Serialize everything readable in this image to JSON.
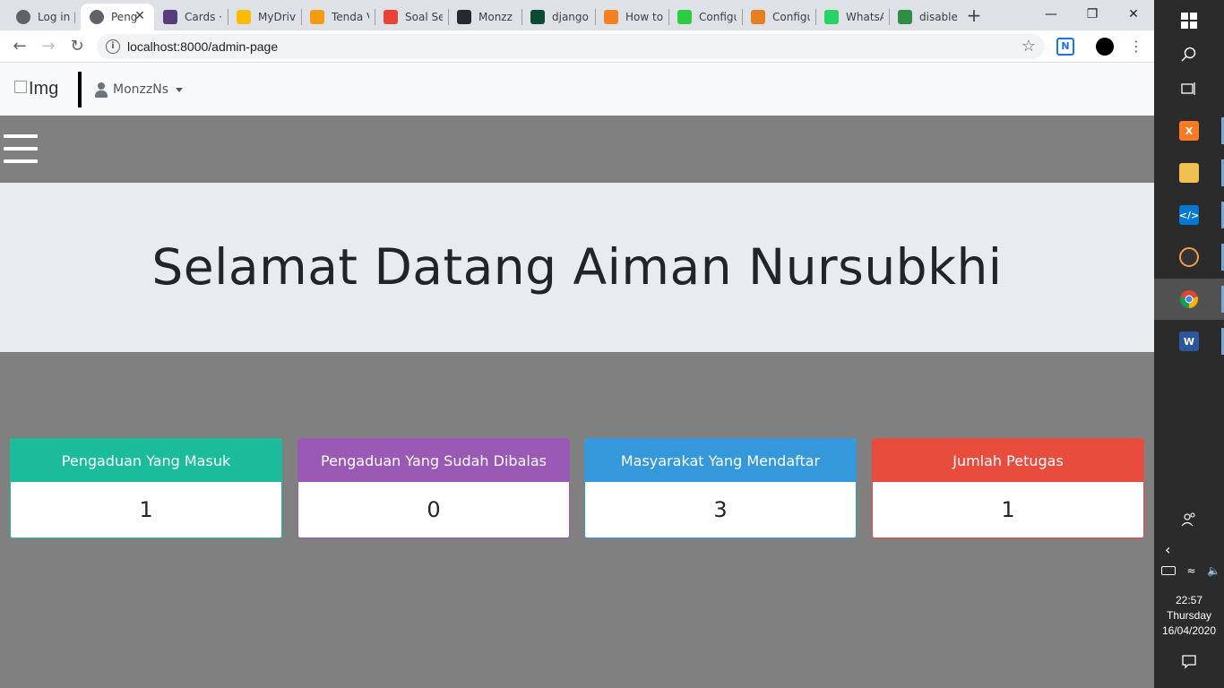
{
  "browser": {
    "tabs": [
      {
        "title": "Log in |",
        "favicon": "globe-icon",
        "color": "#5f6368"
      },
      {
        "title": "Peng",
        "favicon": "globe-icon",
        "color": "#5f6368",
        "active": true
      },
      {
        "title": "Cards ·",
        "favicon": "bootstrap-icon",
        "color": "#563d7c"
      },
      {
        "title": "MyDrive",
        "favicon": "drive-icon",
        "color": "#fbbc04"
      },
      {
        "title": "Tenda V",
        "favicon": "tenda-icon",
        "color": "#f39c12"
      },
      {
        "title": "Soal Se",
        "favicon": "gmail-icon",
        "color": "#ea4335"
      },
      {
        "title": "Monzz",
        "favicon": "github-icon",
        "color": "#24292e"
      },
      {
        "title": "django",
        "favicon": "django-icon",
        "color": "#0c4b33"
      },
      {
        "title": "How to",
        "favicon": "stackoverflow-icon",
        "color": "#f48024"
      },
      {
        "title": "Configu",
        "favicon": "power-icon",
        "color": "#2ecc40"
      },
      {
        "title": "Configu",
        "favicon": "hi-icon",
        "color": "#e67e22"
      },
      {
        "title": "WhatsA",
        "favicon": "whatsapp-icon",
        "color": "#25d366"
      },
      {
        "title": "disablec",
        "favicon": "geeks-icon",
        "color": "#2f8d46"
      }
    ],
    "new_tab_label": "+",
    "url": "localhost:8000/admin-page"
  },
  "navbar": {
    "brand_alt": "Img",
    "username": "MonzzNs"
  },
  "jumbotron": {
    "welcome": "Selamat Datang Aiman Nursubkhi"
  },
  "cards": [
    {
      "title": "Pengaduan Yang Masuk",
      "value": "1",
      "color": "#1abc9c"
    },
    {
      "title": "Pengaduan Yang Sudah Dibalas",
      "value": "0",
      "color": "#9b59b6"
    },
    {
      "title": "Masyarakat Yang Mendaftar",
      "value": "3",
      "color": "#3498db"
    },
    {
      "title": "Jumlah Petugas",
      "value": "1",
      "color": "#e74c3c"
    }
  ],
  "taskbar": {
    "time": "22:57",
    "day": "Thursday",
    "date": "16/04/2020",
    "apps": [
      "windows-start-icon",
      "search-icon",
      "task-view-icon",
      "xampp-icon",
      "file-explorer-icon",
      "vscode-icon",
      "media-player-icon",
      "chrome-icon",
      "word-icon"
    ]
  }
}
